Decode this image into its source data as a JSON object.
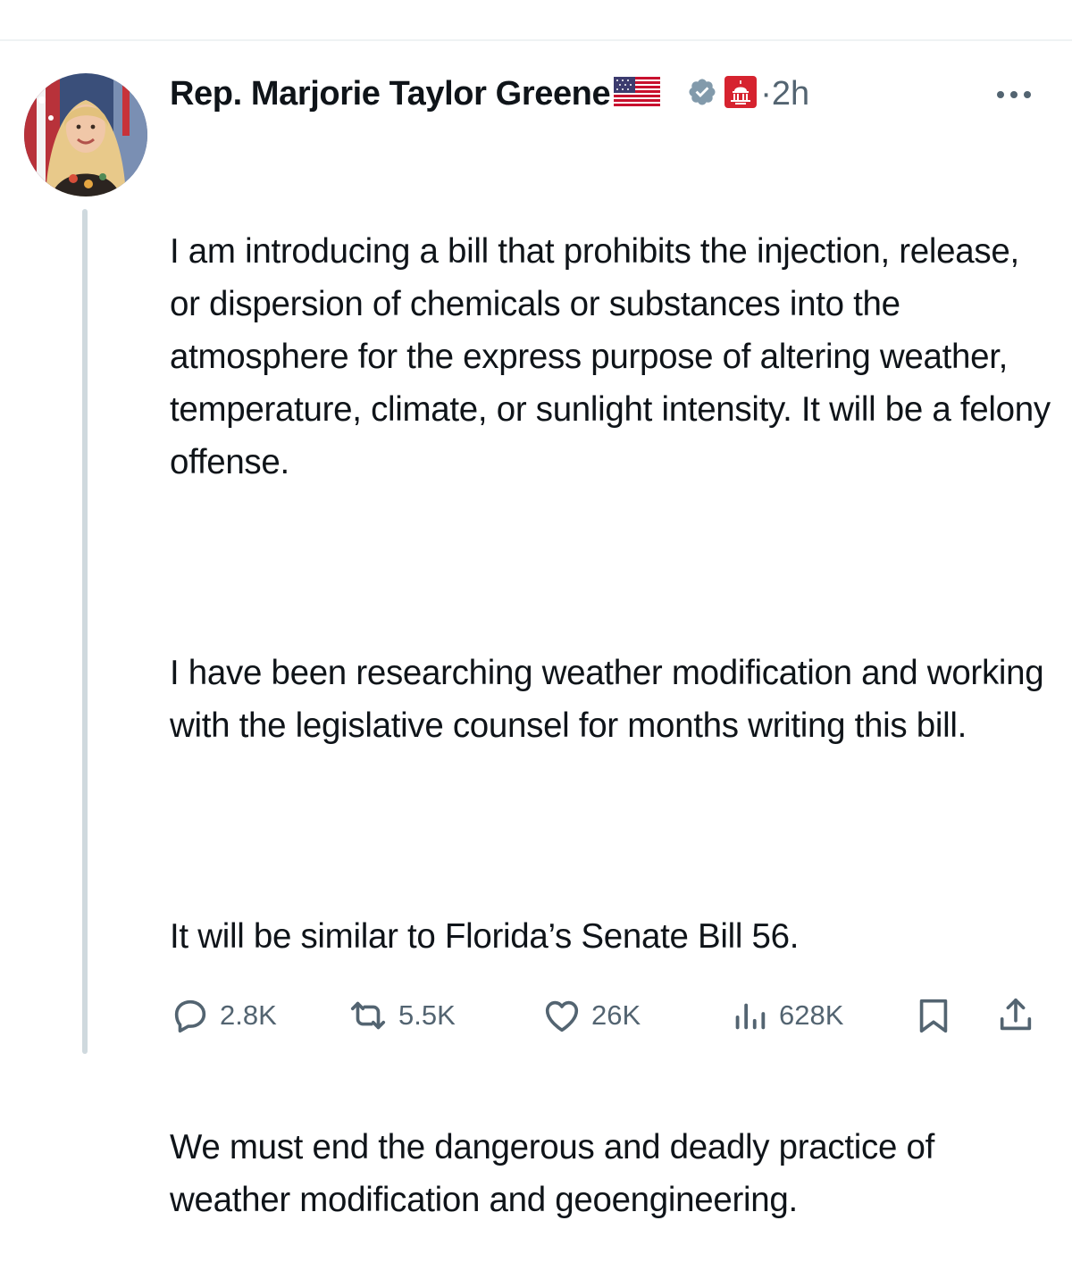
{
  "author": {
    "display_name": "Rep. Marjorie Taylor Greene",
    "flag_icon": "us-flag-icon",
    "verified_icon": "verified-badge-icon",
    "affiliation_icon": "capitol-badge-icon",
    "time_ago": "·2h"
  },
  "tweet": {
    "paragraphs": [
      "I am introducing a bill that prohibits the injection, release, or dispersion of chemicals or substances into the atmosphere for the express purpose of altering weather, temperature, climate, or sunlight intensity. It will be a felony offense.",
      "I have been researching weather modification and working with the legislative counsel for months writing this bill.",
      "It will be similar to Florida’s Senate Bill 56.",
      "We must end the dangerous and deadly practice of weather modification and geoengineering."
    ]
  },
  "actions": {
    "replies": "2.8K",
    "reposts": "5.5K",
    "likes": "26K",
    "views": "628K"
  },
  "colors": {
    "text": "#0f1419",
    "secondary": "#536471",
    "thread_line": "#cfd9de",
    "verified_badge": "#829aab",
    "affiliation_badge": "#d6232f"
  }
}
